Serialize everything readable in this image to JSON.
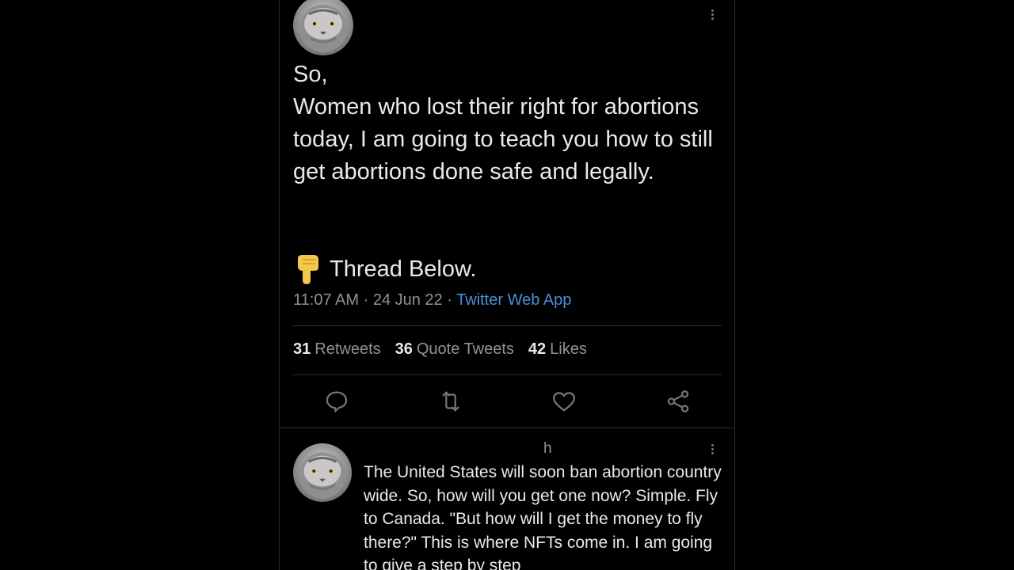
{
  "tweet": {
    "text": "So,\nWomen who lost their right for abortions today, I am going to teach you how to still get abortions done safe and legally.",
    "thread_label": "Thread Below.",
    "time": "11:07 AM",
    "date": "24 Jun 22",
    "app": "Twitter Web App",
    "dot": "·",
    "stats": {
      "retweets_count": "31",
      "retweets_label": "Retweets",
      "quote_count": "36",
      "quote_label": "Quote Tweets",
      "likes_count": "42",
      "likes_label": "Likes"
    }
  },
  "reply": {
    "handle_fragment": "h",
    "text": "The United States will soon ban abortion country wide. So, how will you get one now? Simple. Fly to Canada. \"But how will I get the money to fly there?\" This is where NFTs come in. I am going to give a step by step"
  },
  "icons": {
    "reply": "reply-icon",
    "retweet": "retweet-icon",
    "like": "heart-icon",
    "share": "share-icon",
    "more": "more-icon",
    "pointing": "pointing-down-emoji"
  },
  "colors": {
    "background": "#000000",
    "text": "#e7e9ea",
    "secondary": "#8b9399",
    "link": "#4a8fd8"
  }
}
